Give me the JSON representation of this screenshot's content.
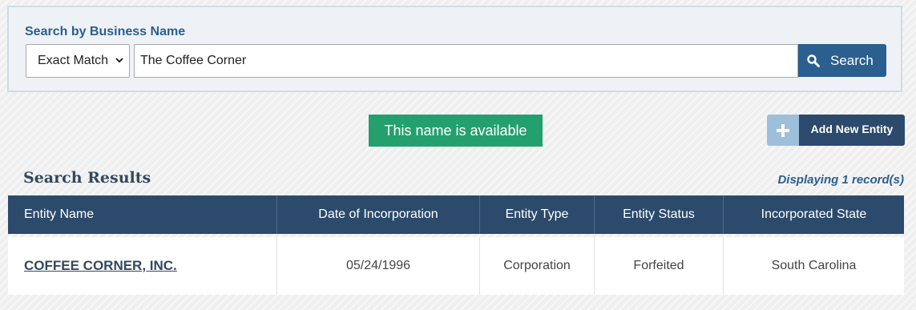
{
  "search": {
    "label": "Search by Business Name",
    "match_type": "Exact Match",
    "query": "The Coffee Corner",
    "button_label": "Search"
  },
  "availability": {
    "message": "This name is available"
  },
  "add_entity": {
    "label": "Add New Entity"
  },
  "results": {
    "title": "Search Results",
    "count_text": "Displaying 1 record(s)",
    "columns": [
      "Entity Name",
      "Date of Incorporation",
      "Entity Type",
      "Entity Status",
      "Incorporated State"
    ],
    "rows": [
      {
        "entity_name": "COFFEE CORNER, INC.",
        "date_of_incorporation": "05/24/1996",
        "entity_type": "Corporation",
        "entity_status": "Forfeited",
        "incorporated_state": "South Carolina"
      }
    ]
  },
  "colors": {
    "primary": "#2a5f8f",
    "header_bg": "#2c4a6b",
    "available_green": "#23a06d",
    "add_icon_bg": "#9ebfda"
  },
  "icons": {
    "search_button": "search-icon",
    "add_entity": "plus-icon",
    "select": "chevron-down-icon"
  }
}
